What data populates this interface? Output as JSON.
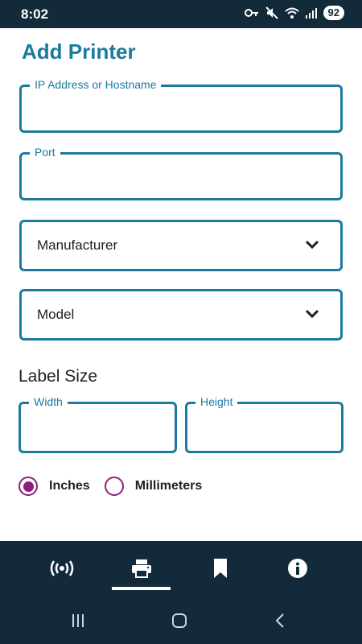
{
  "status_bar": {
    "time": "8:02",
    "battery": "92",
    "icons": [
      "key-icon",
      "mute-icon",
      "wifi-icon",
      "signal-icon"
    ]
  },
  "page": {
    "title": "Add Printer"
  },
  "form": {
    "ip": {
      "label": "IP Address or Hostname",
      "value": ""
    },
    "port": {
      "label": "Port",
      "value": ""
    },
    "manufacturer": {
      "placeholder": "Manufacturer"
    },
    "model": {
      "placeholder": "Model"
    },
    "label_size": {
      "title": "Label Size",
      "width_label": "Width",
      "height_label": "Height"
    },
    "units": {
      "options": [
        "Inches",
        "Millimeters"
      ],
      "selected": "Inches"
    }
  },
  "bottom_nav": {
    "items": [
      "broadcast-icon",
      "printer-icon",
      "bookmark-icon",
      "info-icon"
    ],
    "active": "printer-icon"
  },
  "colors": {
    "accent": "#1b7a9e",
    "radio": "#8b1f7a",
    "dark": "#132a3a"
  }
}
